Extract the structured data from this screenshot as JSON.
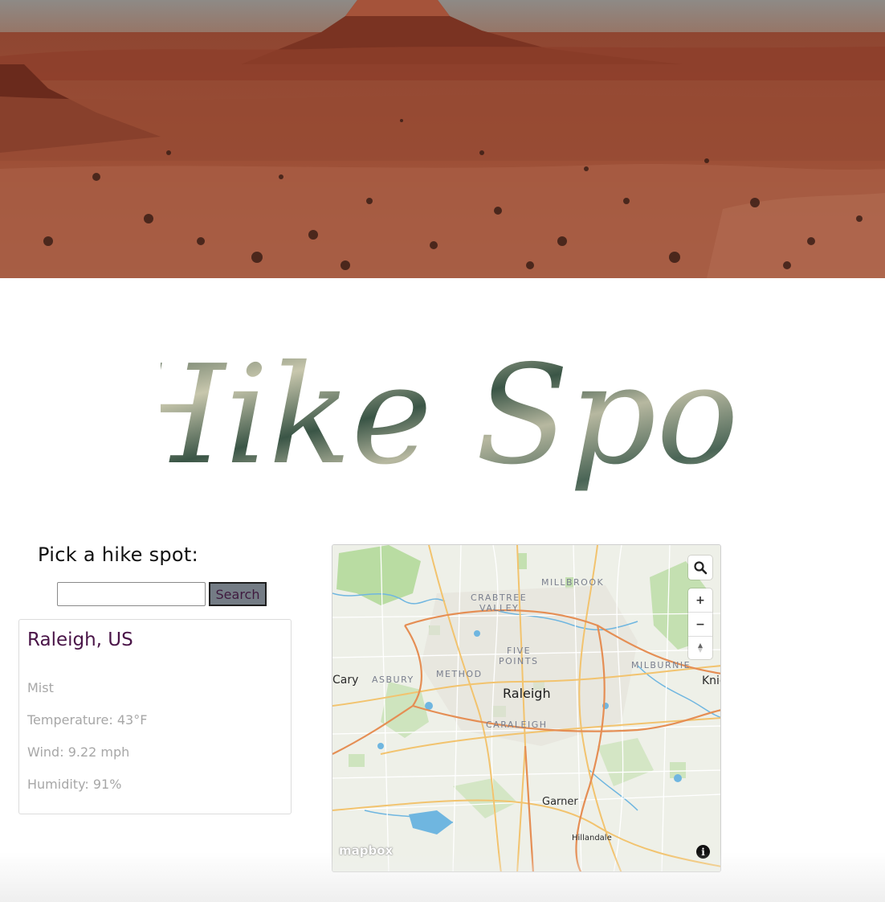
{
  "header": {
    "title": "Hike Spot"
  },
  "search": {
    "label": "Pick a hike spot:",
    "input_value": "",
    "placeholder": "",
    "button_label": "Search"
  },
  "weather": {
    "city": "Raleigh, US",
    "condition": "Mist",
    "temperature": "Temperature: 43°F",
    "wind": "Wind: 9.22 mph",
    "humidity": "Humidity: 91%"
  },
  "map": {
    "labels": {
      "millbrook": "MILLBROOK",
      "crabtree": "CRABTREE",
      "valley": "VALLEY",
      "five": "FIVE",
      "points": "POINTS",
      "milburnie": "MILBURNIE",
      "method": "METHOD",
      "asbury": "ASBURY",
      "cary": "Cary",
      "raleigh": "Raleigh",
      "knightdale": "Knig",
      "caraleigh": "CARALEIGH",
      "garner": "Garner",
      "hillandale": "Hillandale"
    },
    "zoom_in": "+",
    "zoom_out": "−",
    "logo": "mapbox",
    "info": "i"
  },
  "colors": {
    "accent_city": "#4a1548",
    "button_bg": "#747c85",
    "muted_text": "#a7a7a7"
  }
}
